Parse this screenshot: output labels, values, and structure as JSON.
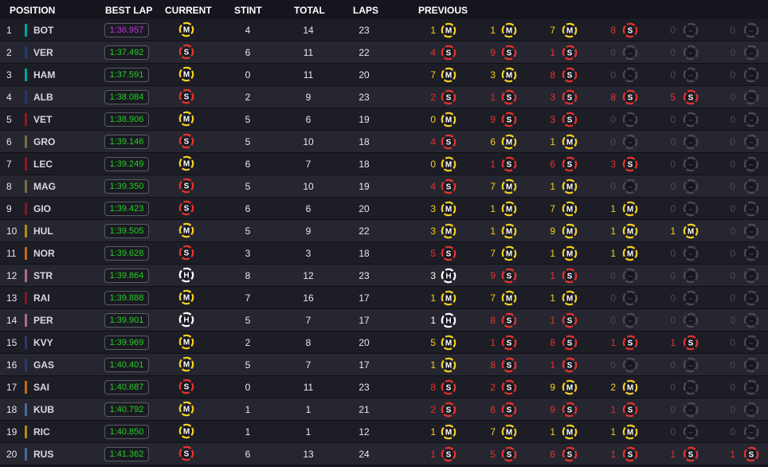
{
  "headers": {
    "position": "POSITION",
    "best_lap": "BEST LAP",
    "current": "CURRENT",
    "stint": "STINT",
    "total": "TOTAL",
    "laps": "LAPS",
    "previous": "PREVIOUS"
  },
  "colors": {
    "fastest_lap": "#c434e6",
    "personal_best": "#22d11f",
    "soft": "#e8322a",
    "medium": "#f5d11f",
    "hard": "#ffffff",
    "empty": "#4a4a52"
  },
  "rows": [
    {
      "pos": "1",
      "driver": "BOT",
      "team": "#00a19b",
      "best_lap": "1:36.957",
      "fastest": true,
      "current": "M",
      "stint": "4",
      "total": "14",
      "laps": "23",
      "previous": [
        {
          "n": "1",
          "t": "M"
        },
        {
          "n": "1",
          "t": "M"
        },
        {
          "n": "7",
          "t": "M"
        },
        {
          "n": "8",
          "t": "S"
        },
        {
          "n": "0",
          "t": "E"
        },
        {
          "n": "0",
          "t": "E"
        }
      ]
    },
    {
      "pos": "2",
      "driver": "VER",
      "team": "#223971",
      "best_lap": "1:37.492",
      "fastest": false,
      "current": "S",
      "stint": "6",
      "total": "11",
      "laps": "22",
      "previous": [
        {
          "n": "4",
          "t": "S"
        },
        {
          "n": "9",
          "t": "S"
        },
        {
          "n": "1",
          "t": "S"
        },
        {
          "n": "0",
          "t": "E"
        },
        {
          "n": "0",
          "t": "E"
        },
        {
          "n": "0",
          "t": "E"
        }
      ]
    },
    {
      "pos": "3",
      "driver": "HAM",
      "team": "#00a19b",
      "best_lap": "1:37.591",
      "fastest": false,
      "current": "M",
      "stint": "0",
      "total": "11",
      "laps": "20",
      "previous": [
        {
          "n": "7",
          "t": "M"
        },
        {
          "n": "3",
          "t": "M"
        },
        {
          "n": "8",
          "t": "S"
        },
        {
          "n": "0",
          "t": "E"
        },
        {
          "n": "0",
          "t": "E"
        },
        {
          "n": "0",
          "t": "E"
        }
      ]
    },
    {
      "pos": "4",
      "driver": "ALB",
      "team": "#223971",
      "best_lap": "1:38.084",
      "fastest": false,
      "current": "S",
      "stint": "2",
      "total": "9",
      "laps": "23",
      "previous": [
        {
          "n": "2",
          "t": "S"
        },
        {
          "n": "1",
          "t": "S"
        },
        {
          "n": "3",
          "t": "S"
        },
        {
          "n": "8",
          "t": "S"
        },
        {
          "n": "5",
          "t": "S"
        },
        {
          "n": "0",
          "t": "E"
        }
      ]
    },
    {
      "pos": "5",
      "driver": "VET",
      "team": "#8a1b23",
      "best_lap": "1:38.906",
      "fastest": false,
      "current": "M",
      "stint": "5",
      "total": "6",
      "laps": "19",
      "previous": [
        {
          "n": "0",
          "t": "M"
        },
        {
          "n": "9",
          "t": "S"
        },
        {
          "n": "3",
          "t": "S"
        },
        {
          "n": "0",
          "t": "E"
        },
        {
          "n": "0",
          "t": "E"
        },
        {
          "n": "0",
          "t": "E"
        }
      ]
    },
    {
      "pos": "6",
      "driver": "GRO",
      "team": "#7a6a4a",
      "best_lap": "1:39.146",
      "fastest": false,
      "current": "S",
      "stint": "5",
      "total": "10",
      "laps": "18",
      "previous": [
        {
          "n": "4",
          "t": "S"
        },
        {
          "n": "6",
          "t": "M"
        },
        {
          "n": "1",
          "t": "M"
        },
        {
          "n": "0",
          "t": "E"
        },
        {
          "n": "0",
          "t": "E"
        },
        {
          "n": "0",
          "t": "E"
        }
      ]
    },
    {
      "pos": "7",
      "driver": "LEC",
      "team": "#8a1b23",
      "best_lap": "1:39.249",
      "fastest": false,
      "current": "M",
      "stint": "6",
      "total": "7",
      "laps": "18",
      "previous": [
        {
          "n": "0",
          "t": "M"
        },
        {
          "n": "1",
          "t": "S"
        },
        {
          "n": "6",
          "t": "S"
        },
        {
          "n": "3",
          "t": "S"
        },
        {
          "n": "0",
          "t": "E"
        },
        {
          "n": "0",
          "t": "E"
        }
      ]
    },
    {
      "pos": "8",
      "driver": "MAG",
      "team": "#7a6a4a",
      "best_lap": "1:39.350",
      "fastest": false,
      "current": "S",
      "stint": "5",
      "total": "10",
      "laps": "19",
      "previous": [
        {
          "n": "4",
          "t": "S"
        },
        {
          "n": "7",
          "t": "M"
        },
        {
          "n": "1",
          "t": "M"
        },
        {
          "n": "0",
          "t": "E"
        },
        {
          "n": "0",
          "t": "E"
        },
        {
          "n": "0",
          "t": "E"
        }
      ]
    },
    {
      "pos": "9",
      "driver": "GIO",
      "team": "#7a1a24",
      "best_lap": "1:39.423",
      "fastest": false,
      "current": "S",
      "stint": "6",
      "total": "6",
      "laps": "20",
      "previous": [
        {
          "n": "3",
          "t": "M"
        },
        {
          "n": "1",
          "t": "M"
        },
        {
          "n": "7",
          "t": "M"
        },
        {
          "n": "1",
          "t": "M"
        },
        {
          "n": "0",
          "t": "E"
        },
        {
          "n": "0",
          "t": "E"
        }
      ]
    },
    {
      "pos": "10",
      "driver": "HUL",
      "team": "#b08a18",
      "best_lap": "1:39.505",
      "fastest": false,
      "current": "M",
      "stint": "5",
      "total": "9",
      "laps": "22",
      "previous": [
        {
          "n": "3",
          "t": "M"
        },
        {
          "n": "1",
          "t": "M"
        },
        {
          "n": "9",
          "t": "M"
        },
        {
          "n": "1",
          "t": "M"
        },
        {
          "n": "1",
          "t": "M"
        },
        {
          "n": "0",
          "t": "E"
        }
      ]
    },
    {
      "pos": "11",
      "driver": "NOR",
      "team": "#c06a1a",
      "best_lap": "1:39.628",
      "fastest": false,
      "current": "S",
      "stint": "3",
      "total": "3",
      "laps": "18",
      "previous": [
        {
          "n": "5",
          "t": "S"
        },
        {
          "n": "7",
          "t": "M"
        },
        {
          "n": "1",
          "t": "M"
        },
        {
          "n": "1",
          "t": "M"
        },
        {
          "n": "0",
          "t": "E"
        },
        {
          "n": "0",
          "t": "E"
        }
      ]
    },
    {
      "pos": "12",
      "driver": "STR",
      "team": "#b06a8a",
      "best_lap": "1:39.864",
      "fastest": false,
      "current": "H",
      "stint": "8",
      "total": "12",
      "laps": "23",
      "previous": [
        {
          "n": "3",
          "t": "H"
        },
        {
          "n": "9",
          "t": "S"
        },
        {
          "n": "1",
          "t": "S"
        },
        {
          "n": "0",
          "t": "E"
        },
        {
          "n": "0",
          "t": "E"
        },
        {
          "n": "0",
          "t": "E"
        }
      ]
    },
    {
      "pos": "13",
      "driver": "RAI",
      "team": "#7a1a24",
      "best_lap": "1:39.888",
      "fastest": false,
      "current": "M",
      "stint": "7",
      "total": "16",
      "laps": "17",
      "previous": [
        {
          "n": "1",
          "t": "M"
        },
        {
          "n": "7",
          "t": "M"
        },
        {
          "n": "1",
          "t": "M"
        },
        {
          "n": "0",
          "t": "E"
        },
        {
          "n": "0",
          "t": "E"
        },
        {
          "n": "0",
          "t": "E"
        }
      ]
    },
    {
      "pos": "14",
      "driver": "PER",
      "team": "#b06a8a",
      "best_lap": "1:39.901",
      "fastest": false,
      "current": "H",
      "stint": "5",
      "total": "7",
      "laps": "17",
      "previous": [
        {
          "n": "1",
          "t": "H"
        },
        {
          "n": "8",
          "t": "S"
        },
        {
          "n": "1",
          "t": "S"
        },
        {
          "n": "0",
          "t": "E"
        },
        {
          "n": "0",
          "t": "E"
        },
        {
          "n": "0",
          "t": "E"
        }
      ]
    },
    {
      "pos": "15",
      "driver": "KVY",
      "team": "#2a3a6a",
      "best_lap": "1:39.969",
      "fastest": false,
      "current": "M",
      "stint": "2",
      "total": "8",
      "laps": "20",
      "previous": [
        {
          "n": "5",
          "t": "M"
        },
        {
          "n": "1",
          "t": "S"
        },
        {
          "n": "8",
          "t": "S"
        },
        {
          "n": "1",
          "t": "S"
        },
        {
          "n": "1",
          "t": "S"
        },
        {
          "n": "0",
          "t": "E"
        }
      ]
    },
    {
      "pos": "16",
      "driver": "GAS",
      "team": "#2a3a6a",
      "best_lap": "1:40.401",
      "fastest": false,
      "current": "M",
      "stint": "5",
      "total": "7",
      "laps": "17",
      "previous": [
        {
          "n": "1",
          "t": "M"
        },
        {
          "n": "8",
          "t": "S"
        },
        {
          "n": "1",
          "t": "S"
        },
        {
          "n": "0",
          "t": "E"
        },
        {
          "n": "0",
          "t": "E"
        },
        {
          "n": "0",
          "t": "E"
        }
      ]
    },
    {
      "pos": "17",
      "driver": "SAI",
      "team": "#c06a1a",
      "best_lap": "1:40.687",
      "fastest": false,
      "current": "S",
      "stint": "0",
      "total": "11",
      "laps": "23",
      "previous": [
        {
          "n": "8",
          "t": "S"
        },
        {
          "n": "2",
          "t": "S"
        },
        {
          "n": "9",
          "t": "M"
        },
        {
          "n": "2",
          "t": "M"
        },
        {
          "n": "0",
          "t": "E"
        },
        {
          "n": "0",
          "t": "E"
        }
      ]
    },
    {
      "pos": "18",
      "driver": "KUB",
      "team": "#4a6a9a",
      "best_lap": "1:40.792",
      "fastest": false,
      "current": "M",
      "stint": "1",
      "total": "1",
      "laps": "21",
      "previous": [
        {
          "n": "2",
          "t": "S"
        },
        {
          "n": "6",
          "t": "S"
        },
        {
          "n": "9",
          "t": "S"
        },
        {
          "n": "1",
          "t": "S"
        },
        {
          "n": "0",
          "t": "E"
        },
        {
          "n": "0",
          "t": "E"
        }
      ]
    },
    {
      "pos": "19",
      "driver": "RIC",
      "team": "#b08a18",
      "best_lap": "1:40.850",
      "fastest": false,
      "current": "M",
      "stint": "1",
      "total": "1",
      "laps": "12",
      "previous": [
        {
          "n": "1",
          "t": "M"
        },
        {
          "n": "7",
          "t": "M"
        },
        {
          "n": "1",
          "t": "M"
        },
        {
          "n": "1",
          "t": "M"
        },
        {
          "n": "0",
          "t": "E"
        },
        {
          "n": "0",
          "t": "E"
        }
      ]
    },
    {
      "pos": "20",
      "driver": "RUS",
      "team": "#4a6a9a",
      "best_lap": "1:41.362",
      "fastest": false,
      "current": "S",
      "stint": "6",
      "total": "13",
      "laps": "24",
      "previous": [
        {
          "n": "1",
          "t": "S"
        },
        {
          "n": "5",
          "t": "S"
        },
        {
          "n": "6",
          "t": "S"
        },
        {
          "n": "1",
          "t": "S"
        },
        {
          "n": "1",
          "t": "S"
        },
        {
          "n": "1",
          "t": "S"
        }
      ]
    }
  ]
}
